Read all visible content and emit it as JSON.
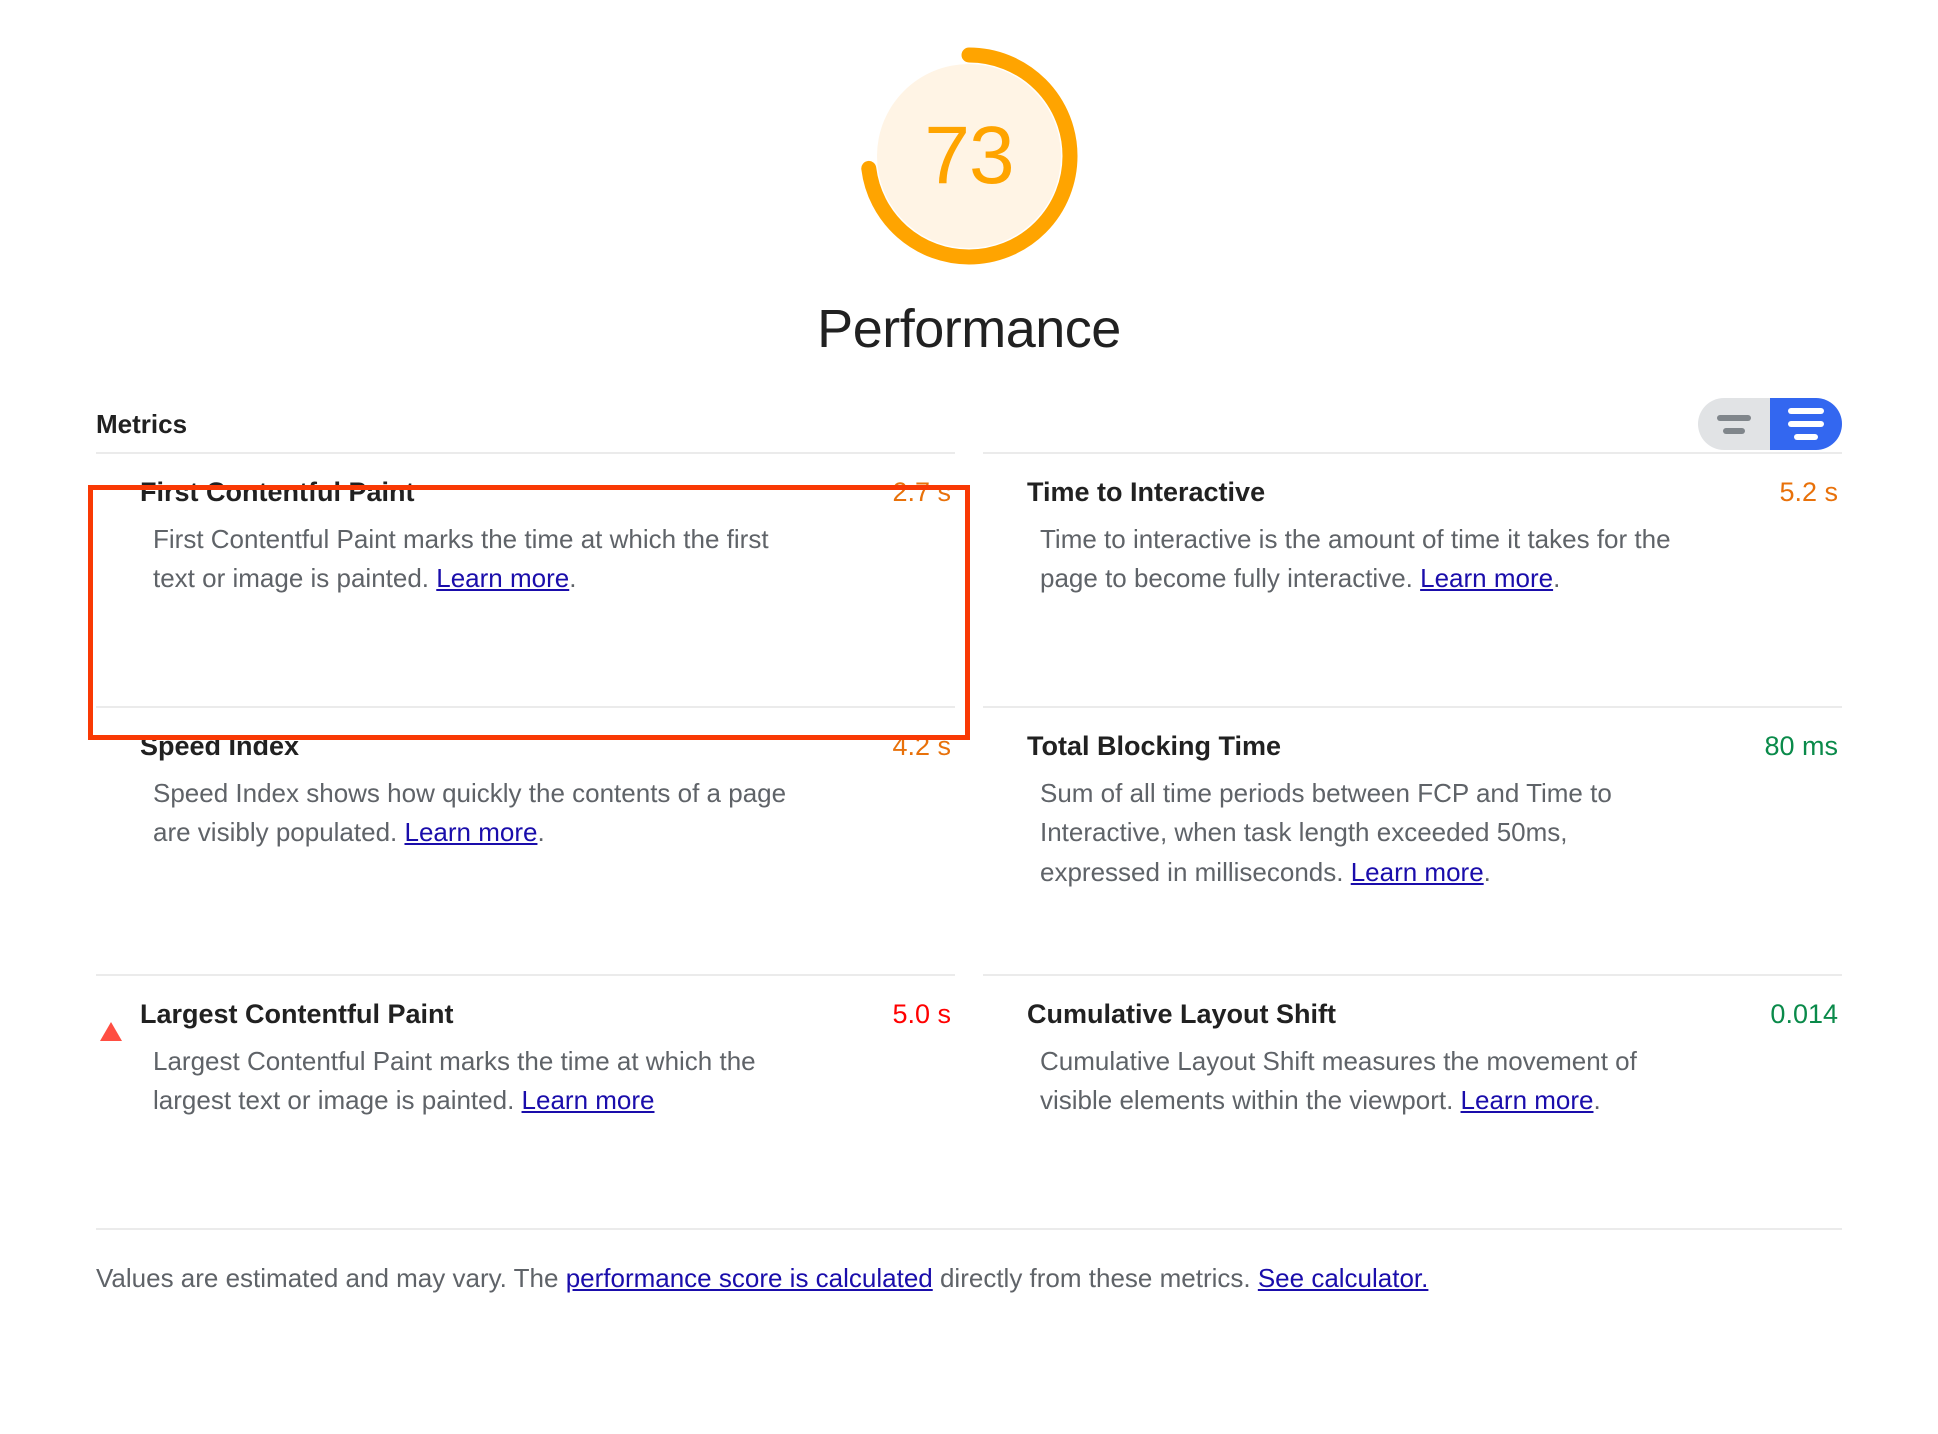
{
  "gauge": {
    "score": "73",
    "title": "Performance",
    "percent": 73,
    "arc_color": "#FFA400",
    "fill_color": "#FFF4E5",
    "score_color": "#FFA400"
  },
  "metrics_section": {
    "title": "Metrics",
    "toggle": {
      "name": "metrics-view-toggle",
      "inactive_option": "simple-view",
      "active_option": "detailed-view",
      "active_color": "#3367F0",
      "inactive_color": "#e1e3e5"
    }
  },
  "metrics": [
    {
      "id": "first-contentful-paint",
      "name": "First Contentful Paint",
      "value": "2.7 s",
      "value_class": "v-orange",
      "value_color": "#E8710A",
      "icon": "square-icon",
      "icon_class": "sq",
      "icon_color": "#FFA400",
      "desc_before": "First Contentful Paint marks the time at which the first text or image is painted. ",
      "link_text": "Learn more",
      "desc_after": ".",
      "highlighted": true
    },
    {
      "id": "time-to-interactive",
      "name": "Time to Interactive",
      "value": "5.2 s",
      "value_class": "v-orange",
      "value_color": "#E8710A",
      "icon": "square-icon",
      "icon_class": "sq",
      "icon_color": "#FFA400",
      "desc_before": "Time to interactive is the amount of time it takes for the page to become fully interactive. ",
      "link_text": "Learn more",
      "desc_after": ".",
      "highlighted": false
    },
    {
      "id": "speed-index",
      "name": "Speed Index",
      "value": "4.2 s",
      "value_class": "v-orange",
      "value_color": "#E8710A",
      "icon": "square-icon",
      "icon_class": "sq",
      "icon_color": "#FFA400",
      "desc_before": "Speed Index shows how quickly the contents of a page are visibly populated. ",
      "link_text": "Learn more",
      "desc_after": ".",
      "highlighted": false
    },
    {
      "id": "total-blocking-time",
      "name": "Total Blocking Time",
      "value": "80 ms",
      "value_class": "v-green",
      "value_color": "#0A8A4A",
      "icon": "circle-icon",
      "icon_class": "circ",
      "icon_color": "#0CCE6B",
      "desc_before": "Sum of all time periods between FCP and Time to Interactive, when task length exceeded 50ms, expressed in milliseconds. ",
      "link_text": "Learn more",
      "desc_after": ".",
      "highlighted": false
    },
    {
      "id": "largest-contentful-paint",
      "name": "Largest Contentful Paint",
      "value": "5.0 s",
      "value_class": "v-red",
      "value_color": "#FF0000",
      "icon": "triangle-icon",
      "icon_class": "tri",
      "icon_color": "#FF4E42",
      "desc_before": "Largest Contentful Paint marks the time at which the largest text or image is painted. ",
      "link_text": "Learn more",
      "desc_after": "",
      "highlighted": false
    },
    {
      "id": "cumulative-layout-shift",
      "name": "Cumulative Layout Shift",
      "value": "0.014",
      "value_class": "v-green",
      "value_color": "#0A8A4A",
      "icon": "circle-icon",
      "icon_class": "circ",
      "icon_color": "#0CCE6B",
      "desc_before": "Cumulative Layout Shift measures the movement of visible elements within the viewport. ",
      "link_text": "Learn more",
      "desc_after": ".",
      "highlighted": false
    }
  ],
  "footer": {
    "part1": "Values are estimated and may vary. The ",
    "link1": "performance score is calculated",
    "part2": " directly from these metrics. ",
    "link2": "See calculator."
  },
  "highlight": {
    "color": "#F93904",
    "target": "first-contentful-paint"
  }
}
